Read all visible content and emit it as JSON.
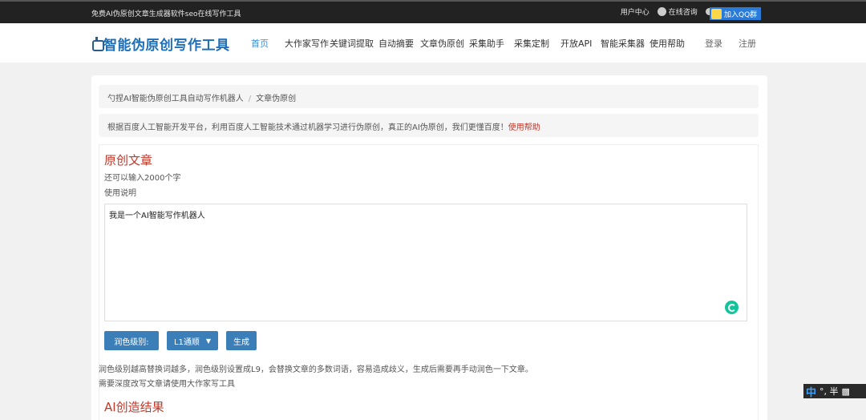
{
  "topbar": {
    "slogan": "免费AI伪原创文章生成器软件seo在线写作工具",
    "user_center": "用户中心",
    "online_consult": "在线咨询",
    "wechat": "微信",
    "qq": "QQ",
    "join_qq": "加入QQ群"
  },
  "logo": {
    "name": "智能伪原创写作工具"
  },
  "nav": {
    "items": [
      "首页",
      "大作家写作",
      "关键词提取",
      "自动摘要",
      "文章伪原创",
      "采集助手",
      "采集定制",
      "开放API",
      "智能采集器",
      "使用帮助"
    ],
    "login": "登录",
    "register": "注册"
  },
  "breadcrumb": {
    "root": "勺捏AI智能伪原创工具自动写作机器人",
    "sep": "/",
    "current": "文章伪原创"
  },
  "notice": {
    "text": "根据百度人工智能开发平台，利用百度人工智能技术通过机器学习进行伪原创，真正的AI伪原创，我们更懂百度！",
    "help_link": "使用帮助"
  },
  "original": {
    "title": "原创文章",
    "remaining": "还可以输入2000个字",
    "instructions": "使用说明",
    "text": "我是一个AI智能写作机器人"
  },
  "controls": {
    "level_label": "润色级别:",
    "level_value": "L1通顺",
    "generate": "生成"
  },
  "desc": {
    "line1": "润色级别越高替换词越多，润色级别设置成L9，会替换文章的多数词语，容易造成歧义，生成后需要再手动润色一下文章。",
    "line2": "需要深度改写文章请使用大作家写工具"
  },
  "result": {
    "title": "AI创造结果"
  },
  "ime": {
    "lang": "中",
    "mode": "°, 半"
  },
  "colors": {
    "accent": "#3c7fb8",
    "heading_red": "#c0392b",
    "nav_active": "#3a8fd8"
  }
}
